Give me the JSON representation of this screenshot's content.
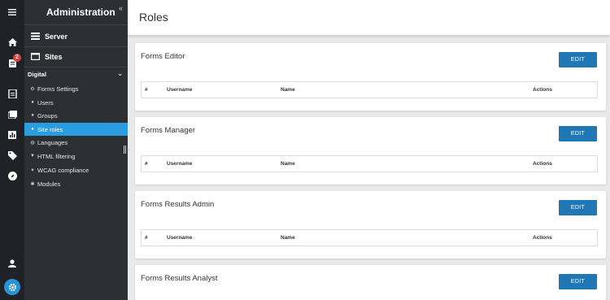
{
  "sidebar": {
    "title": "Administration",
    "collapse_glyph": "«",
    "server_label": "Server",
    "sites_label": "Sites",
    "site_name": "Digital",
    "items": [
      {
        "label": "Forms Settings",
        "icon": "gear-icon"
      },
      {
        "label": "Users",
        "icon": "user-icon"
      },
      {
        "label": "Groups",
        "icon": "users-icon"
      },
      {
        "label": "Site roles",
        "icon": "dot-icon",
        "active": true
      },
      {
        "label": "Languages",
        "icon": "globe-icon"
      },
      {
        "label": "HTML filtering",
        "icon": "filter-icon"
      },
      {
        "label": "WCAG compliance",
        "icon": "accessibility-icon"
      },
      {
        "label": "Modules",
        "icon": "puzzle-icon"
      }
    ]
  },
  "rail": {
    "badge_count": "2",
    "icons": [
      "menu-icon",
      "home-icon",
      "clipboard-icon",
      "document-icon",
      "gallery-icon",
      "bar-chart-icon",
      "tag-icon",
      "compass-icon",
      "user-icon",
      "settings-icon"
    ]
  },
  "main": {
    "title": "Roles",
    "edit_label": "EDIT",
    "columns": [
      "#",
      "Username",
      "Name",
      "Actions"
    ],
    "roles": [
      {
        "title": "Forms Editor"
      },
      {
        "title": "Forms Manager"
      },
      {
        "title": "Forms Results Admin"
      },
      {
        "title": "Forms Results Analyst"
      }
    ]
  },
  "colors": {
    "rail_bg": "#1f2226",
    "sidebar_bg": "#2c3035",
    "active_item": "#2a9ce0",
    "edit_button": "#1f78b4",
    "badge": "#d9413b",
    "page_bg": "#e9e9e9"
  }
}
